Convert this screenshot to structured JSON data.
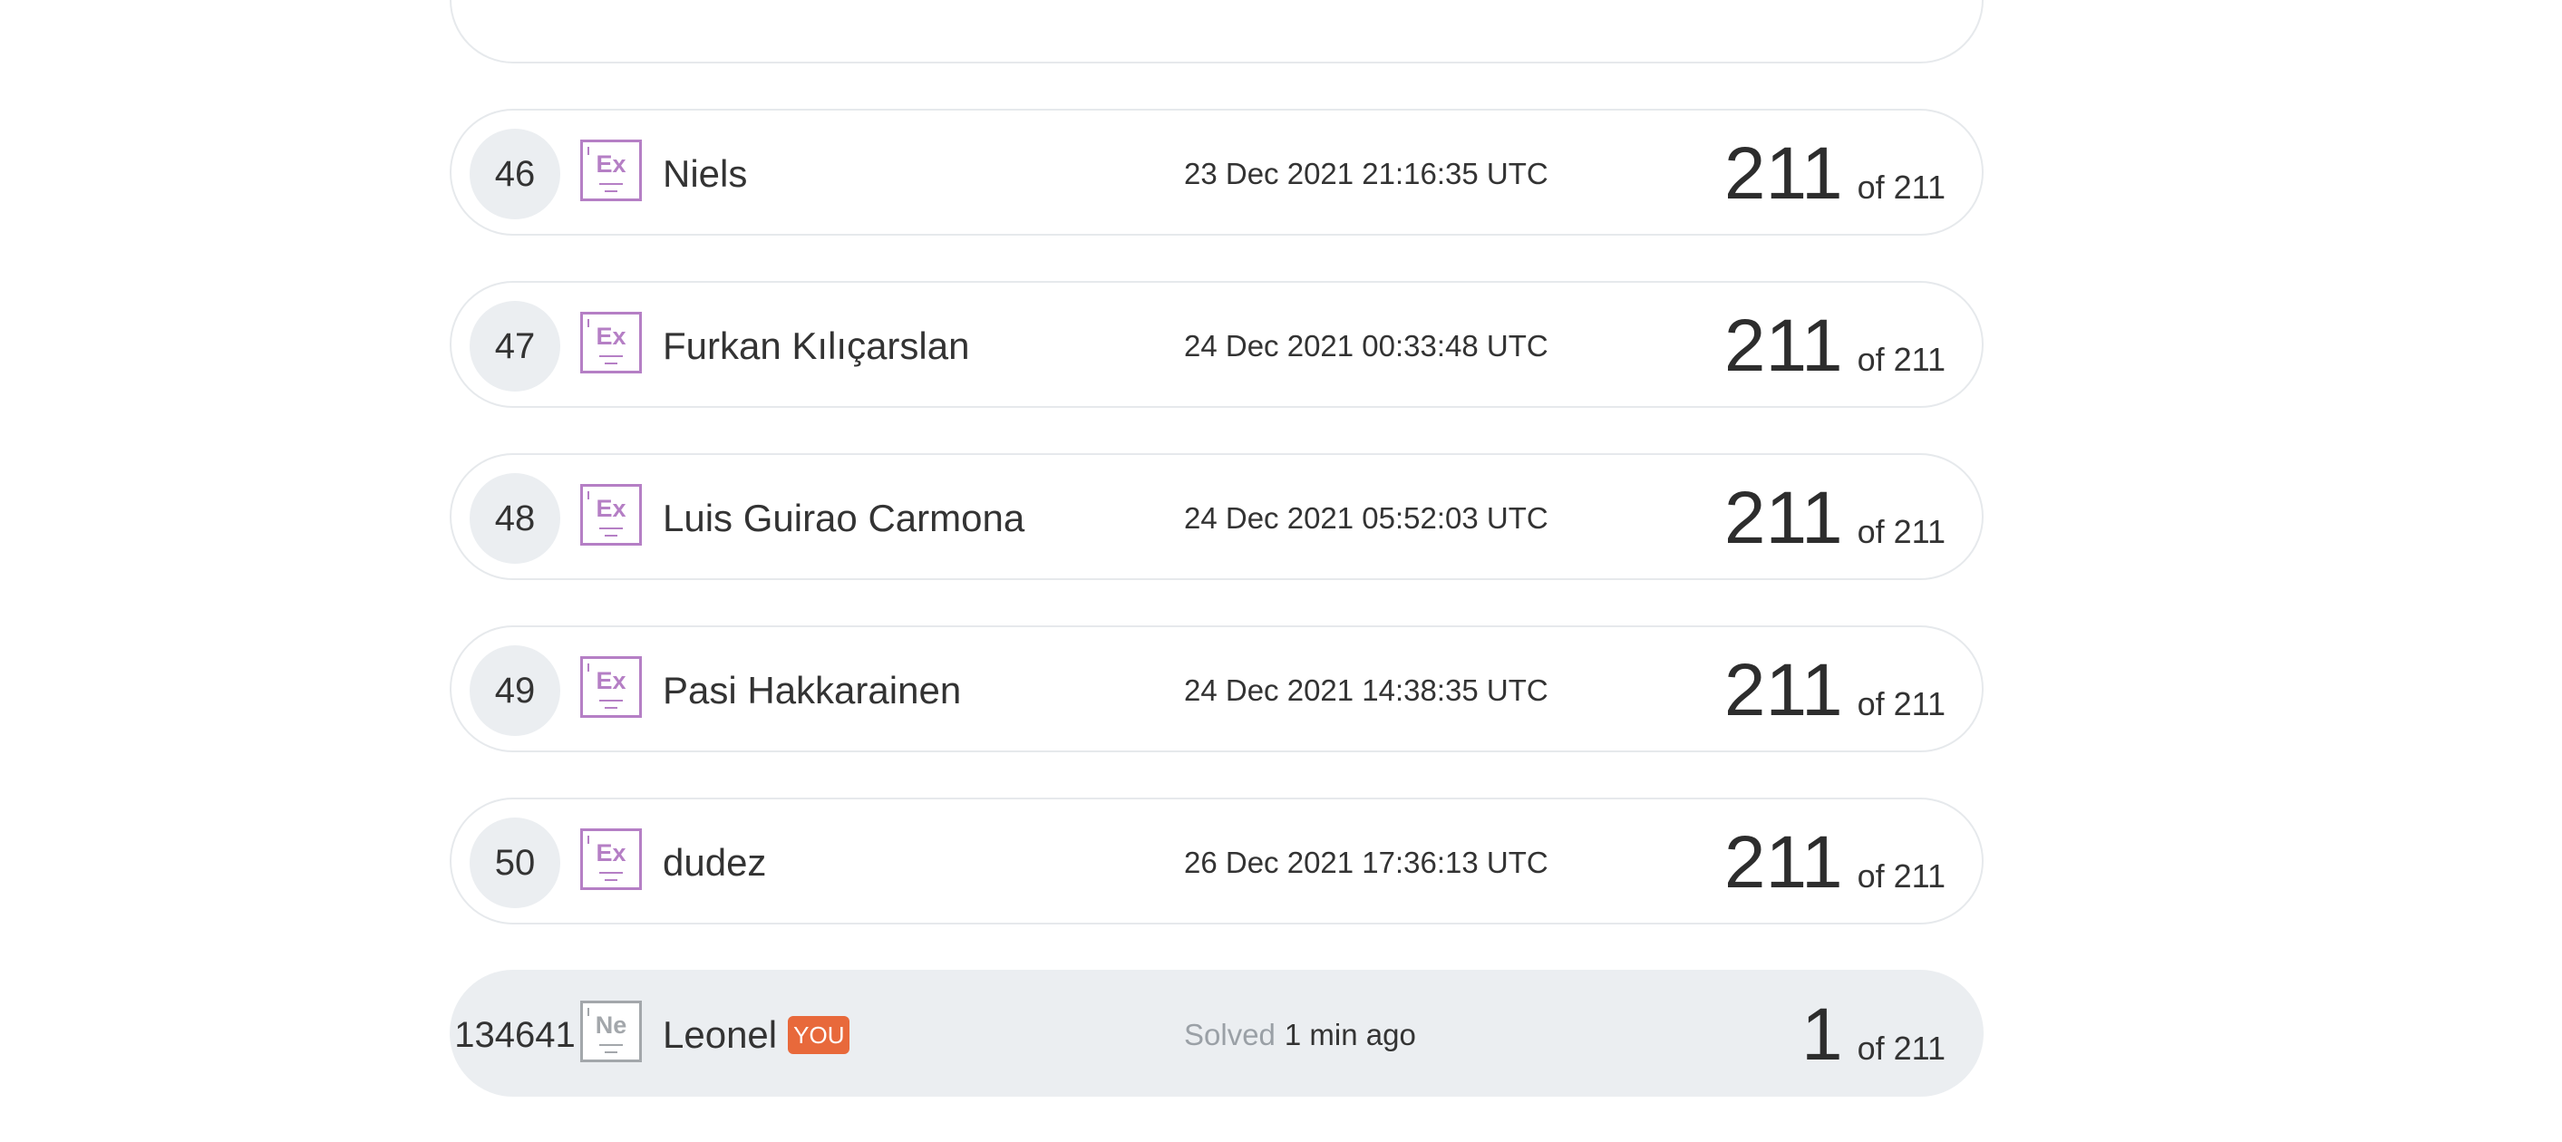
{
  "leaderboard": {
    "rows": [
      {
        "rank": "46",
        "badge": "Ex",
        "name": "Niels",
        "time": "23 Dec 2021 21:16:35 UTC",
        "score": "211",
        "total": "of 211"
      },
      {
        "rank": "47",
        "badge": "Ex",
        "name": "Furkan Kılıçarslan",
        "time": "24 Dec 2021 00:33:48 UTC",
        "score": "211",
        "total": "of 211"
      },
      {
        "rank": "48",
        "badge": "Ex",
        "name": "Luis Guirao Carmona",
        "time": "24 Dec 2021 05:52:03 UTC",
        "score": "211",
        "total": "of 211"
      },
      {
        "rank": "49",
        "badge": "Ex",
        "name": "Pasi Hakkarainen",
        "time": "24 Dec 2021 14:38:35 UTC",
        "score": "211",
        "total": "of 211"
      },
      {
        "rank": "50",
        "badge": "Ex",
        "name": "dudez",
        "time": "26 Dec 2021 17:36:13 UTC",
        "score": "211",
        "total": "of 211"
      }
    ],
    "current_user": {
      "rank": "134641",
      "badge": "Ne",
      "name": "Leonel",
      "you_label": "YOU",
      "solved_label": "Solved",
      "time": "1 min ago",
      "score": "1",
      "total": "of 211"
    }
  },
  "colors": {
    "expert_badge": "#b57fc5",
    "newbie_badge": "#a3a7ab",
    "you_tag": "#e8693b",
    "current_row_bg": "#ebeef1"
  }
}
